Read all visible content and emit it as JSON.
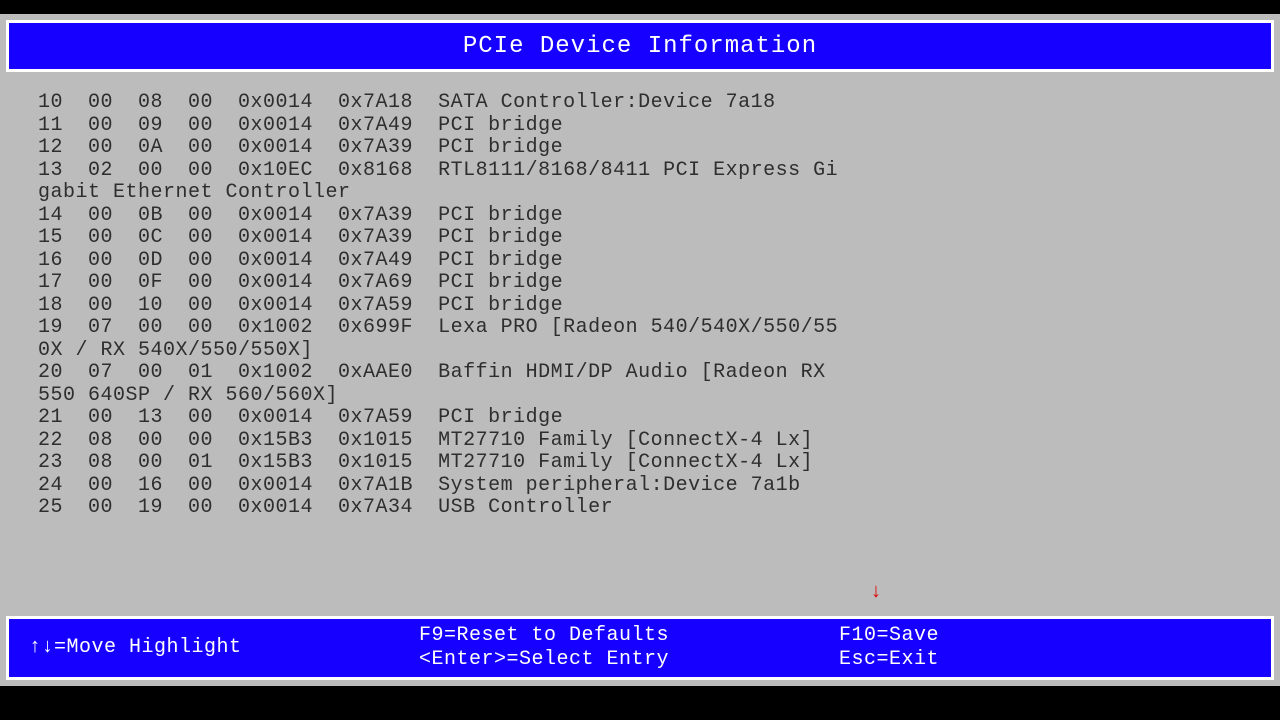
{
  "title": "PCIe Device Information",
  "devices": [
    {
      "idx": "10",
      "bus": "00",
      "dev": "08",
      "fn": "00",
      "vendor": "0x0014",
      "device": "0x7A18",
      "name": "SATA Controller:Device 7a18"
    },
    {
      "idx": "11",
      "bus": "00",
      "dev": "09",
      "fn": "00",
      "vendor": "0x0014",
      "device": "0x7A49",
      "name": "PCI bridge"
    },
    {
      "idx": "12",
      "bus": "00",
      "dev": "0A",
      "fn": "00",
      "vendor": "0x0014",
      "device": "0x7A39",
      "name": "PCI bridge"
    },
    {
      "idx": "13",
      "bus": "02",
      "dev": "00",
      "fn": "00",
      "vendor": "0x10EC",
      "device": "0x8168",
      "name": "RTL8111/8168/8411 PCI Express Gigabit Ethernet Controller"
    },
    {
      "idx": "14",
      "bus": "00",
      "dev": "0B",
      "fn": "00",
      "vendor": "0x0014",
      "device": "0x7A39",
      "name": "PCI bridge"
    },
    {
      "idx": "15",
      "bus": "00",
      "dev": "0C",
      "fn": "00",
      "vendor": "0x0014",
      "device": "0x7A39",
      "name": "PCI bridge"
    },
    {
      "idx": "16",
      "bus": "00",
      "dev": "0D",
      "fn": "00",
      "vendor": "0x0014",
      "device": "0x7A49",
      "name": "PCI bridge"
    },
    {
      "idx": "17",
      "bus": "00",
      "dev": "0F",
      "fn": "00",
      "vendor": "0x0014",
      "device": "0x7A69",
      "name": "PCI bridge"
    },
    {
      "idx": "18",
      "bus": "00",
      "dev": "10",
      "fn": "00",
      "vendor": "0x0014",
      "device": "0x7A59",
      "name": "PCI bridge"
    },
    {
      "idx": "19",
      "bus": "07",
      "dev": "00",
      "fn": "00",
      "vendor": "0x1002",
      "device": "0x699F",
      "name": "Lexa PRO [Radeon 540/540X/550/550X / RX 540X/550/550X]"
    },
    {
      "idx": "20",
      "bus": "07",
      "dev": "00",
      "fn": "01",
      "vendor": "0x1002",
      "device": "0xAAE0",
      "name": "Baffin HDMI/DP Audio [Radeon RX 550 640SP / RX 560/560X]"
    },
    {
      "idx": "21",
      "bus": "00",
      "dev": "13",
      "fn": "00",
      "vendor": "0x0014",
      "device": "0x7A59",
      "name": "PCI bridge"
    },
    {
      "idx": "22",
      "bus": "08",
      "dev": "00",
      "fn": "00",
      "vendor": "0x15B3",
      "device": "0x1015",
      "name": "MT27710 Family [ConnectX-4 Lx]"
    },
    {
      "idx": "23",
      "bus": "08",
      "dev": "00",
      "fn": "01",
      "vendor": "0x15B3",
      "device": "0x1015",
      "name": "MT27710 Family [ConnectX-4 Lx]"
    },
    {
      "idx": "24",
      "bus": "00",
      "dev": "16",
      "fn": "00",
      "vendor": "0x0014",
      "device": "0x7A1B",
      "name": "System peripheral:Device 7a1b"
    },
    {
      "idx": "25",
      "bus": "00",
      "dev": "19",
      "fn": "00",
      "vendor": "0x0014",
      "device": "0x7A34",
      "name": "USB Controller"
    }
  ],
  "scroll": {
    "can_up": true,
    "can_down": true
  },
  "footer": {
    "move": "↑↓=Move Highlight",
    "reset": "F9=Reset to Defaults",
    "select": "<Enter>=Select Entry",
    "save": "F10=Save",
    "exit": "Esc=Exit"
  },
  "layout": {
    "wrap_col": 64
  }
}
